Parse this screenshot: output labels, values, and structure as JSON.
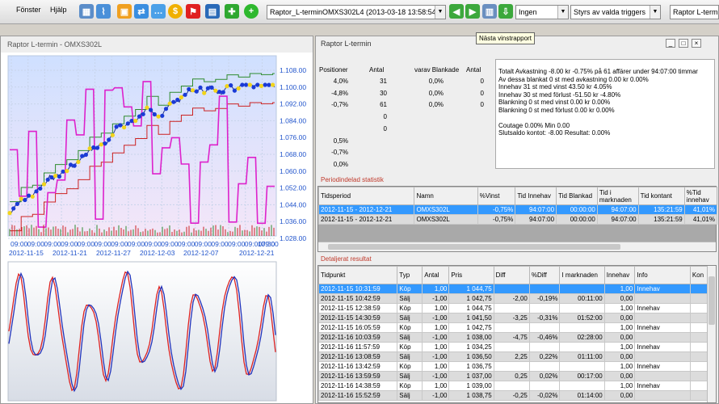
{
  "menu": {
    "window": "Fönster",
    "help": "Hjälp"
  },
  "toolbar": {
    "strategy_combo": "Raptor_L-terminOMXS302L4  (2013-03-18 13:58:54 )",
    "filter_combo": "Ingen",
    "trigger_combo": "Styrs av valda triggers",
    "right_combo": "Raptor L-termin",
    "tooltip": "Nästa vinstrapport"
  },
  "chart_panel": {
    "title": "Raptor L-termin - OMXS302L",
    "price_chart": {
      "y_ticks": [
        "1.108.00",
        "1.100.00",
        "1.092.00",
        "1.084.00",
        "1.076.00",
        "1.068.00",
        "1.060.00",
        "1.052.00",
        "1.044.00",
        "1.036.00",
        "1.028.00"
      ],
      "x_time_labels": [
        "09:00",
        "09:00",
        "09:00",
        "09:00",
        "09:00",
        "09:00",
        "09:00",
        "09:00",
        "09:00",
        "09:00",
        "09:00",
        "09:00",
        "09:00",
        "09:00",
        "09:00",
        "09:00",
        "17:30"
      ],
      "x_date_labels": [
        "2012-11-15",
        "2012-11-21",
        "2012-11-27",
        "2012-12-03",
        "2012-12-07",
        "2012-12-21"
      ]
    }
  },
  "result_panel": {
    "title": "Raptor L-termin",
    "positions_header": {
      "positioner": "Positioner",
      "antal": "Antal",
      "blankade": "varav Blankade",
      "antal2": "Antal"
    },
    "positions": [
      {
        "pct": "4,0%",
        "antal": "31",
        "blank": "0,0%",
        "antal2": "0"
      },
      {
        "pct": "-4,8%",
        "antal": "30",
        "blank": "0,0%",
        "antal2": "0"
      },
      {
        "pct": "-0,7%",
        "antal": "61",
        "blank": "0,0%",
        "antal2": "0"
      },
      {
        "pct": "",
        "antal": "0",
        "blank": "",
        "antal2": ""
      },
      {
        "pct": "",
        "antal": "0",
        "blank": "",
        "antal2": ""
      },
      {
        "pct": "0,5%",
        "antal": "",
        "blank": "",
        "antal2": ""
      },
      {
        "pct": "-0,7%",
        "antal": "",
        "blank": "",
        "antal2": ""
      },
      {
        "pct": "0,0%",
        "antal": "",
        "blank": "",
        "antal2": ""
      }
    ],
    "summary_lines": [
      "Totalt Avkastning  -8.00 kr  -0.75% på 61 affärer under 94:07:00 timmar",
      "Av dessa blankat 0 st med avkastning   0.00 kr  0.00%",
      "Innehav 31 st med vinst  43.50 kr  4.05%",
      "Innehav 30 st med förlust  -51.50 kr  -4.80%",
      "Blankning 0 st med vinst   0.00 kr  0.00%",
      "Blankning 0 st med förlust   0.00 kr  0.00%",
      "",
      "Coutage 0.00% Min 0.00",
      "Slutsaldo kontot: -8.00 Resultat: 0.00%"
    ],
    "period_title": "Periodindelad statistik",
    "period_headers": [
      "Tidsperiod",
      "Namn",
      "%Vinst",
      "Tid Innehav",
      "Tid Blankad",
      "Tid i marknaden",
      "Tid kontant",
      "%Tid innehav"
    ],
    "period_rows": [
      [
        "2012-11-15  -  2012-12-21",
        "OMXS302L",
        "-0,75%",
        "94:07:00",
        "00:00:00",
        "94:07:00",
        "135:21:59",
        "41,01%"
      ],
      [
        "2012-11-15  -  2012-12-21",
        "OMXS302L",
        "-0,75%",
        "94:07:00",
        "00:00:00",
        "94:07:00",
        "135:21:59",
        "41,01%"
      ]
    ],
    "detail_title": "Detaljerat resultat",
    "detail_headers": [
      "Tidpunkt",
      "Typ",
      "Antal",
      "Pris",
      "Diff",
      "%Diff",
      "I marknaden",
      "Innehav",
      "Info",
      "Kon"
    ],
    "detail_rows": [
      [
        "2012-11-15 10:31:59",
        "Köp",
        "1,00",
        "1 044,75",
        "",
        "",
        "",
        "1,00",
        "Innehav",
        ""
      ],
      [
        "2012-11-15 10:42:59",
        "Sälj",
        "-1,00",
        "1 042,75",
        "-2,00",
        "-0,19%",
        "00:11:00",
        "0,00",
        "",
        ""
      ],
      [
        "2012-11-15 12:38:59",
        "Köp",
        "1,00",
        "1 044,75",
        "",
        "",
        "",
        "1,00",
        "Innehav",
        ""
      ],
      [
        "2012-11-15 14:30:59",
        "Sälj",
        "-1,00",
        "1 041,50",
        "-3,25",
        "-0,31%",
        "01:52:00",
        "0,00",
        "",
        ""
      ],
      [
        "2012-11-15 16:05:59",
        "Köp",
        "1,00",
        "1 042,75",
        "",
        "",
        "",
        "1,00",
        "Innehav",
        ""
      ],
      [
        "2012-11-16 10:03:59",
        "Sälj",
        "-1,00",
        "1 038,00",
        "-4,75",
        "-0,46%",
        "02:28:00",
        "0,00",
        "",
        ""
      ],
      [
        "2012-11-16 11:57:59",
        "Köp",
        "1,00",
        "1 034,25",
        "",
        "",
        "",
        "1,00",
        "Innehav",
        ""
      ],
      [
        "2012-11-16 13:08:59",
        "Sälj",
        "-1,00",
        "1 036,50",
        "2,25",
        "0,22%",
        "01:11:00",
        "0,00",
        "",
        ""
      ],
      [
        "2012-11-16 13:42:59",
        "Köp",
        "1,00",
        "1 036,75",
        "",
        "",
        "",
        "1,00",
        "Innehav",
        ""
      ],
      [
        "2012-11-16 13:59:59",
        "Sälj",
        "-1,00",
        "1 037,00",
        "0,25",
        "0,02%",
        "00:17:00",
        "0,00",
        "",
        ""
      ],
      [
        "2012-11-16 14:38:59",
        "Köp",
        "1,00",
        "1 039,00",
        "",
        "",
        "",
        "1,00",
        "Innehav",
        ""
      ],
      [
        "2012-11-16 15:52:59",
        "Sälj",
        "-1,00",
        "1 038,75",
        "-0,25",
        "-0,02%",
        "01:14:00",
        "0,00",
        "",
        ""
      ]
    ]
  }
}
